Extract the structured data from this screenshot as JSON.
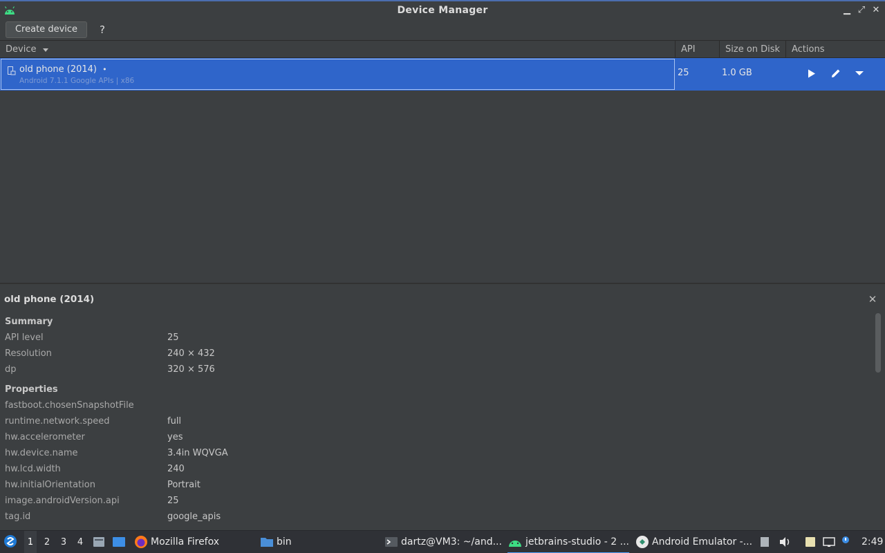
{
  "window": {
    "title": "Device Manager",
    "controls": {
      "minimize": "▁",
      "restore": "⤢",
      "close": "✕"
    }
  },
  "toolbar": {
    "create_label": "Create device",
    "help_label": "?"
  },
  "table": {
    "columns": {
      "device": "Device",
      "api": "API",
      "size": "Size on Disk",
      "actions": "Actions"
    },
    "rows": [
      {
        "name": "old phone (2014)",
        "status_dot": "•",
        "subtitle": "Android 7.1.1 Google APIs | x86",
        "api": "25",
        "size": "1.0 GB",
        "actions": [
          "play-icon",
          "edit-icon",
          "dropdown-icon"
        ]
      }
    ]
  },
  "details": {
    "title": "old phone (2014)",
    "summary_heading": "Summary",
    "summary": [
      {
        "key": "API level",
        "value": "25"
      },
      {
        "key": "Resolution",
        "value": "240 × 432"
      },
      {
        "key": "dp",
        "value": "320 × 576"
      }
    ],
    "properties_heading": "Properties",
    "properties": [
      {
        "key": "fastboot.chosenSnapshotFile",
        "value": ""
      },
      {
        "key": "runtime.network.speed",
        "value": "full"
      },
      {
        "key": "hw.accelerometer",
        "value": "yes"
      },
      {
        "key": "hw.device.name",
        "value": "3.4in WQVGA"
      },
      {
        "key": "hw.lcd.width",
        "value": "240"
      },
      {
        "key": "hw.initialOrientation",
        "value": "Portrait"
      },
      {
        "key": "image.androidVersion.api",
        "value": "25"
      },
      {
        "key": "tag.id",
        "value": "google_apis"
      }
    ]
  },
  "taskbar": {
    "workspaces": [
      "1",
      "2",
      "3",
      "4"
    ],
    "tasks": [
      {
        "label": "Mozilla Firefox",
        "icon": "firefox-icon"
      },
      {
        "label": "bin",
        "icon": "folder-icon"
      },
      {
        "label": "dartz@VM3: ~/and...",
        "icon": "terminal-icon"
      },
      {
        "label": "jetbrains-studio - 2 ...",
        "icon": "android-icon"
      },
      {
        "label": "Android Emulator -...",
        "icon": "emulator-icon"
      }
    ],
    "clock": "2:49"
  },
  "colors": {
    "accent": "#2f65ca",
    "background": "#3c3f41",
    "taskbar": "#2f3136"
  }
}
